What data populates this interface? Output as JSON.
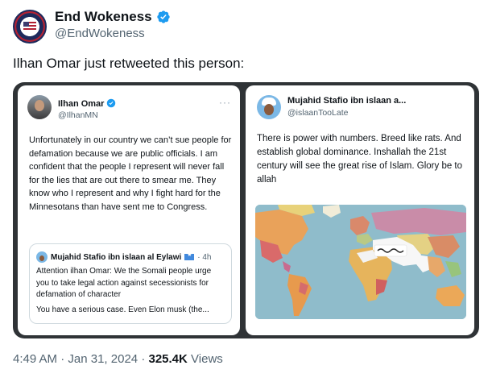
{
  "author": {
    "display_name": "End Wokeness",
    "handle": "@EndWokeness",
    "avatar_icon": "flag-badge-icon",
    "verified_icon": "verified-badge-icon",
    "verified_color": "#1d9bf0"
  },
  "tweet": {
    "text": "Ilhan Omar just retweeted this person:"
  },
  "media": {
    "left_card": {
      "name": "Ilhan Omar",
      "handle": "@IlhanMN",
      "more": "···",
      "body": "Unfortunately in our country we can’t sue people for defamation because we are public officials. I am confident that the people I represent will never fall for the lies that are out there to smear me. They know who I represent and why I fight hard for the  Minnesotans than have sent me to Congress.",
      "quote": {
        "name": "Mujahid Stafio ibn islaan al Eylawi",
        "time": "· 4h",
        "body": "Attention ilhan Omar: We the Somali people urge you to take legal action against secessionists for defamation of character",
        "more": "You have a serious case. Even Elon musk (the..."
      }
    },
    "right_card": {
      "name": "Mujahid Stafio ibn islaan a...",
      "handle": "@islaanTooLate",
      "body": "There is power with numbers. Breed like rats. And establish global dominance. Inshallah the 21st century will see the great rise of Islam. Glory be to allah",
      "image_icon": "world-map-image"
    }
  },
  "footer": {
    "time": "4:49 AM",
    "date": "Jan 31, 2024",
    "views_count": "325.4K",
    "views_label": "Views",
    "separator": "·"
  }
}
